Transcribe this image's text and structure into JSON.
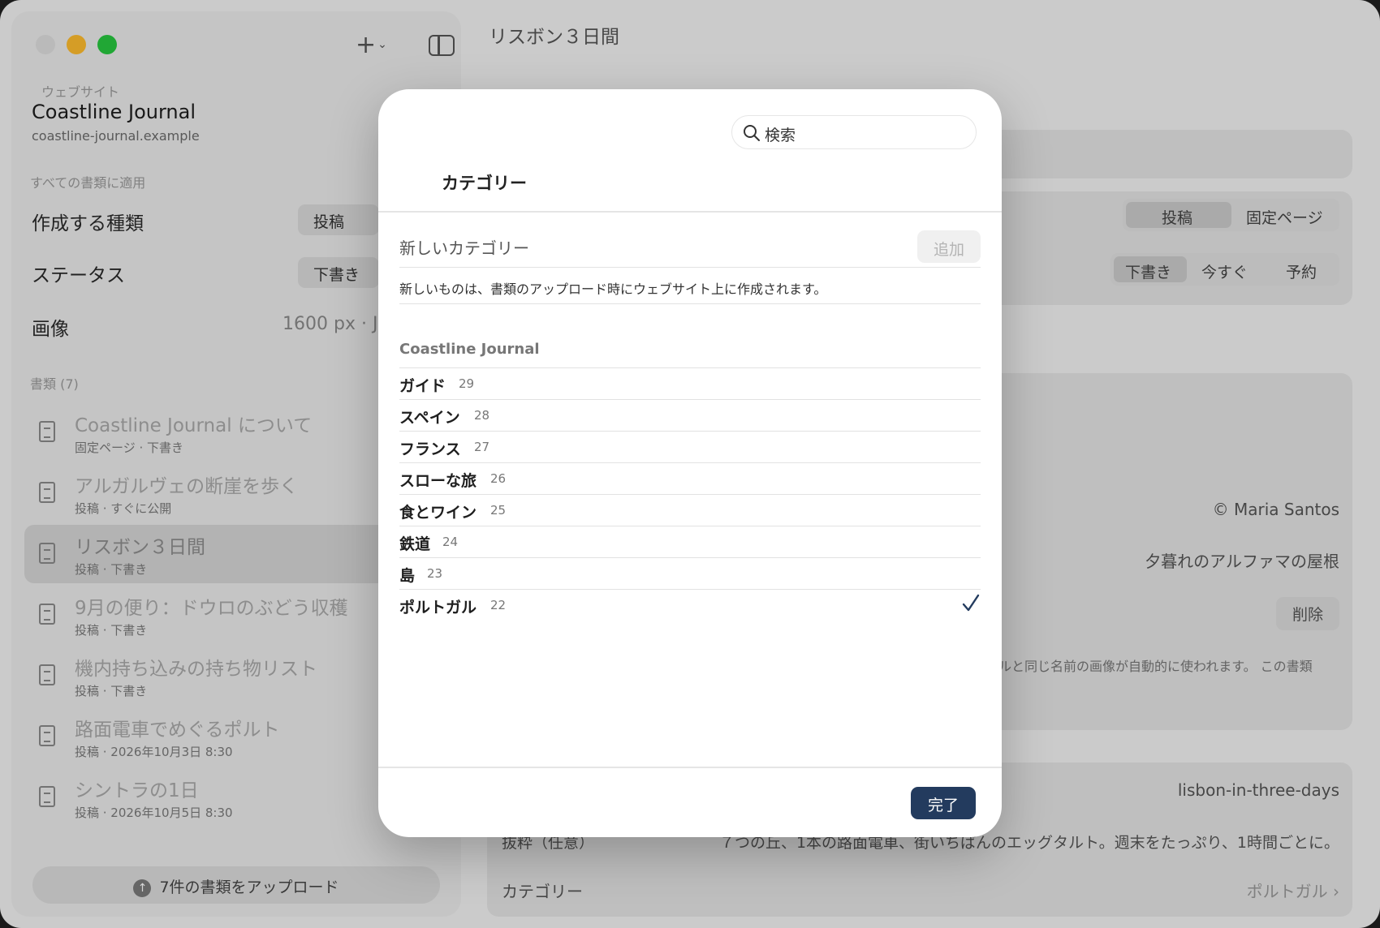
{
  "window": {
    "title": "リスボン３日間"
  },
  "sidebar": {
    "website_label": "ウェブサイト",
    "site_name": "Coastline Journal",
    "site_url": "coastline-journal.example",
    "apply_all_label": "すべての書類に適用",
    "settings": {
      "kind_label": "作成する種類",
      "kind_value": "投稿",
      "status_label": "ステータス",
      "status_value": "下書き",
      "image_label": "画像",
      "image_value": "1600 px · J"
    },
    "documents_label": "書類 (7)",
    "documents": [
      {
        "title": "Coastline Journal について",
        "sub": "固定ページ · 下書き"
      },
      {
        "title": "アルガルヴェの断崖を歩く",
        "sub": "投稿 · すぐに公開"
      },
      {
        "title": "リスボン３日間",
        "sub": "投稿 · 下書き"
      },
      {
        "title": "9月の便り：ドウロのぶどう収穫",
        "sub": "投稿 · 下書き"
      },
      {
        "title": "機内持ち込みの持ち物リスト",
        "sub": "投稿 · 下書き"
      },
      {
        "title": "路面電車でめぐるポルト",
        "sub": "投稿 · 2026年10月3日 8:30"
      },
      {
        "title": "シントラの1日",
        "sub": "投稿 · 2026年10月5日 8:30"
      }
    ],
    "upload_label": "7件の書類をアップロード"
  },
  "main": {
    "type_segment": [
      "投稿",
      "固定ページ"
    ],
    "status_segment": [
      "下書き",
      "今すぐ",
      "予約"
    ],
    "copyright": "© Maria Santos",
    "alt_text": "夕暮れのアルファマの屋根",
    "delete_label": "削除",
    "image_note": "ルと同じ名前の画像が自動的に使われます。 この書類",
    "slug": "lisbon-in-three-days",
    "excerpt_label": "抜粋（任意）",
    "excerpt": "７つの丘、1本の路面電車、街いちばんのエッグタルト。週末をたっぷり、1時間ごとに。",
    "category_label": "カテゴリー",
    "category_value": "ポルトガル"
  },
  "modal": {
    "search_placeholder": "検索",
    "title": "カテゴリー",
    "new_category_label": "新しいカテゴリー",
    "add_label": "追加",
    "note": "新しいものは、書類のアップロード時にウェブサイト上に作成されます。",
    "group_name": "Coastline Journal",
    "categories": [
      {
        "name": "ガイド",
        "count": "29",
        "checked": false
      },
      {
        "name": "スペイン",
        "count": "28",
        "checked": false
      },
      {
        "name": "フランス",
        "count": "27",
        "checked": false
      },
      {
        "name": "スローな旅",
        "count": "26",
        "checked": false
      },
      {
        "name": "食とワイン",
        "count": "25",
        "checked": false
      },
      {
        "name": "鉄道",
        "count": "24",
        "checked": false
      },
      {
        "name": "島",
        "count": "23",
        "checked": false
      },
      {
        "name": "ポルトガル",
        "count": "22",
        "checked": true
      }
    ],
    "done_label": "完了",
    "accent_color": "#233b5e"
  }
}
